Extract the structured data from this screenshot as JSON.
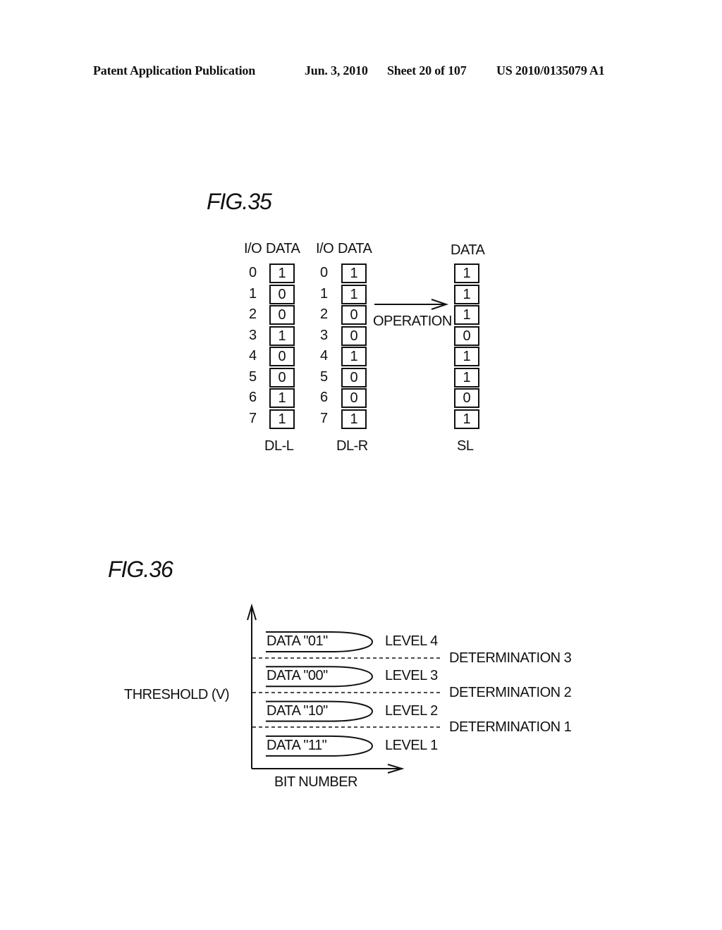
{
  "header": {
    "publication": "Patent Application Publication",
    "date": "Jun. 3, 2010",
    "sheet": "Sheet 20 of 107",
    "number": "US 2010/0135079 A1"
  },
  "fig35": {
    "label": "FIG.35",
    "left": {
      "io_header": "I/O",
      "data_header": "DATA",
      "name": "DL-L",
      "io": [
        "0",
        "1",
        "2",
        "3",
        "4",
        "5",
        "6",
        "7"
      ],
      "bits": [
        "1",
        "0",
        "0",
        "1",
        "0",
        "0",
        "1",
        "1"
      ]
    },
    "right": {
      "io_header": "I/O",
      "data_header": "DATA",
      "name": "DL-R",
      "io": [
        "0",
        "1",
        "2",
        "3",
        "4",
        "5",
        "6",
        "7"
      ],
      "bits": [
        "1",
        "1",
        "0",
        "0",
        "1",
        "0",
        "0",
        "1"
      ]
    },
    "operation_label": "OPERATION",
    "result": {
      "data_header": "DATA",
      "name": "SL",
      "bits": [
        "1",
        "1",
        "1",
        "0",
        "1",
        "1",
        "0",
        "1"
      ]
    }
  },
  "fig36": {
    "label": "FIG.36",
    "y_axis_label": "THRESHOLD (V)",
    "x_axis_label": "BIT NUMBER",
    "distributions": [
      {
        "data": "DATA \"01\"",
        "level": "LEVEL 4"
      },
      {
        "data": "DATA \"00\"",
        "level": "LEVEL 3"
      },
      {
        "data": "DATA \"10\"",
        "level": "LEVEL 2"
      },
      {
        "data": "DATA \"11\"",
        "level": "LEVEL 1"
      }
    ],
    "determinations": [
      "DETERMINATION 3",
      "DETERMINATION 2",
      "DETERMINATION 1"
    ]
  }
}
